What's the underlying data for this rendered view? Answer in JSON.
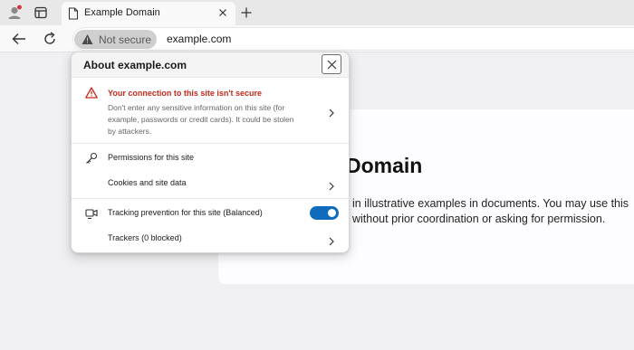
{
  "browser": {
    "tab": {
      "title": "Example Domain"
    },
    "address_bar": {
      "security_chip": {
        "label": "Not secure",
        "icon": "warning-triangle-icon"
      },
      "url": "example.com"
    }
  },
  "page": {
    "heading": "Domain",
    "body_lines": [
      "in illustrative examples in documents. You may use this",
      "without prior coordination or asking for permission."
    ]
  },
  "site_info_popup": {
    "title": "About example.com",
    "security": {
      "title": "Your connection to this site isn't secure",
      "description_lines": [
        "Don't enter any sensitive information on this site (for",
        "example, passwords or credit cards). It could be stolen",
        "by attackers."
      ]
    },
    "permissions_label": "Permissions for this site",
    "cookies_label": "Cookies and site data",
    "tracking_label": "Tracking prevention for this site (Balanced)",
    "tracking_enabled": true,
    "trackers_label": "Trackers (0 blocked)"
  },
  "colors": {
    "warning_red": "#c42b1c",
    "toggle_blue": "#0f6cbd"
  }
}
